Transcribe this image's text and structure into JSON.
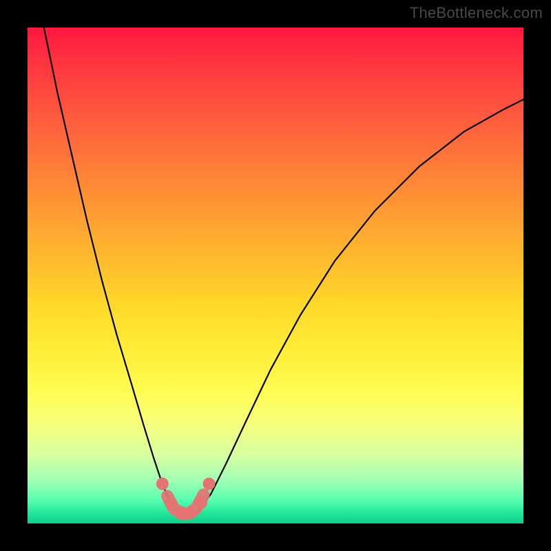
{
  "watermark": "TheBottleneck.com",
  "colors": {
    "background": "#000000",
    "gradient_top": "#ff163f",
    "gradient_bottom": "#0fcf8c",
    "curve_stroke": "#000000",
    "highlight": "#e57373"
  },
  "chart_data": {
    "type": "line",
    "title": "",
    "xlabel": "",
    "ylabel": "",
    "xlim": [
      0,
      1
    ],
    "ylim": [
      0,
      1
    ],
    "series": [
      {
        "name": "left-branch",
        "x": [
          0.033,
          0.06,
          0.09,
          0.12,
          0.15,
          0.18,
          0.21,
          0.235,
          0.255,
          0.27,
          0.282,
          0.292,
          0.3
        ],
        "y": [
          1.0,
          0.87,
          0.74,
          0.61,
          0.49,
          0.38,
          0.28,
          0.195,
          0.13,
          0.085,
          0.055,
          0.035,
          0.025
        ]
      },
      {
        "name": "right-branch",
        "x": [
          0.345,
          0.37,
          0.4,
          0.44,
          0.49,
          0.55,
          0.62,
          0.7,
          0.79,
          0.88,
          0.96,
          1.0
        ],
        "y": [
          0.025,
          0.06,
          0.12,
          0.205,
          0.31,
          0.42,
          0.53,
          0.63,
          0.72,
          0.79,
          0.835,
          0.855
        ]
      },
      {
        "name": "highlight-valley",
        "x": [
          0.282,
          0.295,
          0.31,
          0.325,
          0.34,
          0.355
        ],
        "y": [
          0.055,
          0.03,
          0.02,
          0.02,
          0.03,
          0.058
        ]
      }
    ],
    "highlight_dots": [
      {
        "x": 0.272,
        "y": 0.08
      },
      {
        "x": 0.29,
        "y": 0.04
      },
      {
        "x": 0.31,
        "y": 0.022
      },
      {
        "x": 0.33,
        "y": 0.022
      },
      {
        "x": 0.35,
        "y": 0.042
      },
      {
        "x": 0.366,
        "y": 0.08
      }
    ]
  }
}
